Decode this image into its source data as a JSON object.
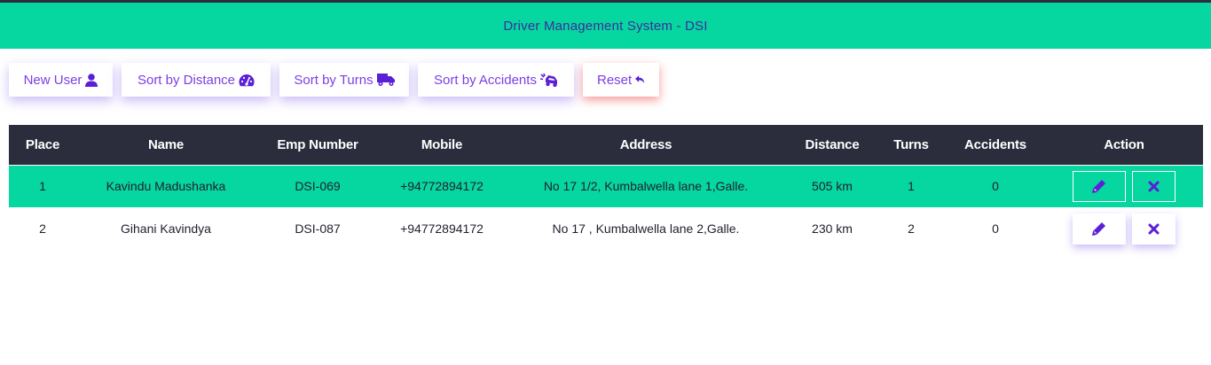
{
  "header": {
    "title": "Driver Management System - DSI"
  },
  "toolbar": {
    "new_user": "New User",
    "sort_distance": "Sort by Distance",
    "sort_turns": "Sort by Turns",
    "sort_accidents": "Sort by Accidents",
    "reset": "Reset"
  },
  "table": {
    "columns": [
      "Place",
      "Name",
      "Emp Number",
      "Mobile",
      "Address",
      "Distance",
      "Turns",
      "Accidents",
      "Action"
    ],
    "rows": [
      {
        "place": "1",
        "name": "Kavindu Madushanka",
        "emp": "DSI-069",
        "mobile": "+94772894172",
        "address": "No 17 1/2, Kumbalwella lane 1,Galle.",
        "distance": "505 km",
        "turns": "1",
        "accidents": "0"
      },
      {
        "place": "2",
        "name": "Gihani Kavindya",
        "emp": "DSI-087",
        "mobile": "+94772894172",
        "address": "No 17 , Kumbalwella lane 2,Galle.",
        "distance": "230 km",
        "turns": "2",
        "accidents": "0"
      }
    ]
  },
  "icons": {
    "new_user": "user-icon",
    "sort_distance": "tachometer-icon",
    "sort_turns": "truck-icon",
    "sort_accidents": "car-crash-icon",
    "reset": "undo-icon",
    "edit": "pencil-icon",
    "delete": "close-icon"
  },
  "colors": {
    "accent_green": "#06d6a0",
    "header_dark": "#2b2d3c",
    "button_text": "#7b3fe4",
    "icon_purple": "#5a1fd6",
    "reset_glow": "#ef4747"
  }
}
